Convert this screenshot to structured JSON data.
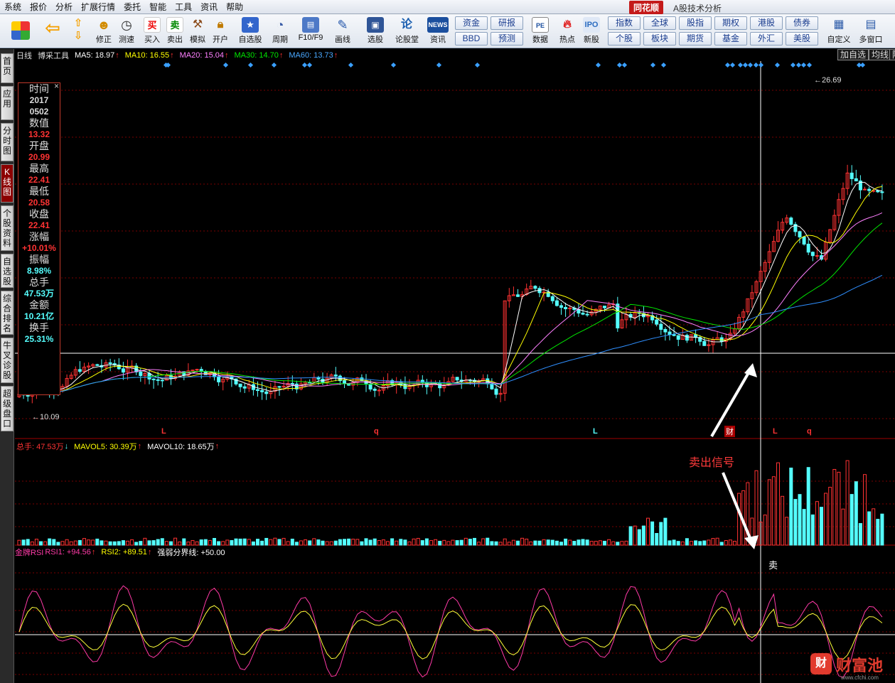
{
  "menubar": {
    "items": [
      "系统",
      "报价",
      "分析",
      "扩展行情",
      "委托",
      "智能",
      "工具",
      "资讯",
      "帮助"
    ],
    "brand": "同花顺",
    "title": "A股技术分析"
  },
  "toolbar": {
    "buttons": [
      "修正",
      "测速",
      "买入",
      "卖出",
      "模拟",
      "开户",
      "自选股",
      "周期",
      "F10/F9",
      "画线",
      "选股",
      "论股堂",
      "资讯",
      "数据",
      "热点",
      "新股",
      "自定义",
      "多窗口"
    ],
    "blue_buttons": [
      "资金",
      "BBD",
      "研报",
      "预测",
      "指数",
      "个股",
      "全球",
      "板块",
      "股指",
      "期货",
      "期权",
      "基金",
      "港股",
      "外汇",
      "债券",
      "美股"
    ]
  },
  "left_tabs": [
    "首页",
    "应用",
    "分时图",
    "K线图",
    "个股资料",
    "自选股",
    "综合排名",
    "牛叉诊股",
    "超级盘口"
  ],
  "header": {
    "chart_type": "日线",
    "tool": "博采工具",
    "ma5": "MA5: 18.97",
    "ma10": "MA10: 16.55",
    "ma20": "MA20: 15.04",
    "ma30": "MA30: 14.70",
    "ma60": "MA60: 13.73",
    "add_watch": "加自选",
    "avg_line": "均线",
    "other": "陈"
  },
  "info_panel": [
    [
      "时间",
      "2017\n0502"
    ],
    [
      "数值",
      "13.32"
    ],
    [
      "开盘",
      "20.99"
    ],
    [
      "最高",
      "22.41"
    ],
    [
      "最低",
      "20.58"
    ],
    [
      "收盘",
      "22.41"
    ],
    [
      "涨幅",
      "+10.01%"
    ],
    [
      "振幅",
      "8.98%"
    ],
    [
      "总手",
      "47.53万"
    ],
    [
      "金额",
      "10.21亿"
    ],
    [
      "换手",
      "25.31%"
    ]
  ],
  "price_labels": {
    "high": "26.69",
    "low": "10.09",
    "marker_L1": "L",
    "marker_q1": "q",
    "marker_L2": "L",
    "marker_cai": "财",
    "marker_L3": "L",
    "marker_q2": "q"
  },
  "volume": {
    "total": "总手: 47.53万",
    "mavol5": "MAVOL5: 30.39万",
    "mavol10": "MAVOL10: 18.65万"
  },
  "rsi": {
    "title": "金牌RSI",
    "rsi1": "RSI1: +94.56",
    "rsi2": "RSI2: +89.51",
    "mid": "强弱分界线: +50.00",
    "sell": "卖"
  },
  "annotation": {
    "sell_signal": "卖出信号"
  },
  "watermark": {
    "text": "财富池",
    "url": "www.cfchi.com"
  },
  "colors": {
    "up": "#ff3232",
    "down": "#54ffff",
    "ma5": "#ffffff",
    "ma10": "#ffff00",
    "ma20": "#ff80ff",
    "ma30": "#00e600",
    "ma60": "#2f8fff"
  }
}
